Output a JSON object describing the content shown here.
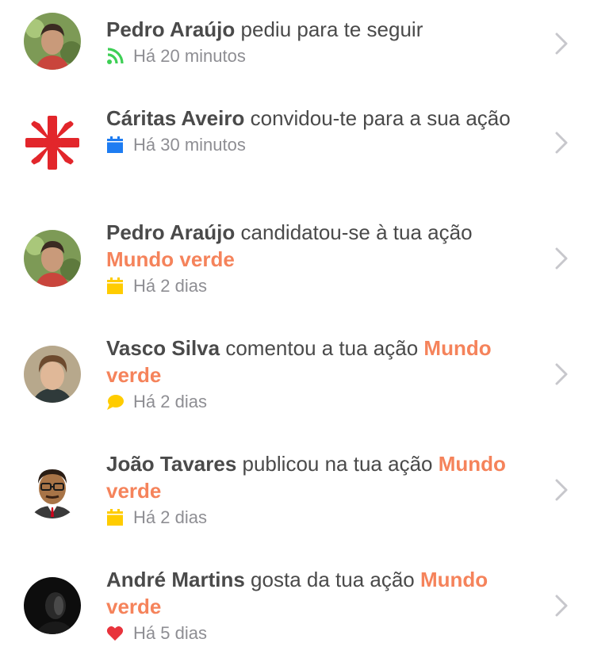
{
  "notifications": [
    {
      "actor": "Pedro Araújo",
      "action": "pediu para te seguir",
      "link": "",
      "time": "Há 20 minutos",
      "icon": "rss-icon",
      "icon_color": "#3ecf55"
    },
    {
      "actor": "Cáritas Aveiro",
      "action": "convidou-te para a sua ação",
      "link": "",
      "time": "Há 30 minutos",
      "icon": "calendar-icon",
      "icon_color": "#1e7cf2"
    },
    {
      "actor": "Pedro Araújo",
      "action": "candidatou-se à tua ação",
      "link": "Mundo verde",
      "time": "Há 2 dias",
      "icon": "calendar-icon",
      "icon_color": "#ffcc00"
    },
    {
      "actor": "Vasco Silva",
      "action": "comentou a tua ação",
      "link": "Mundo verde",
      "time": "Há 2 dias",
      "icon": "comment-bubble-icon",
      "icon_color": "#ffcc00"
    },
    {
      "actor": "João Tavares",
      "action": "publicou na tua ação",
      "link": "Mundo verde",
      "time": "Há 2 dias",
      "icon": "calendar-icon",
      "icon_color": "#ffcc00"
    },
    {
      "actor": "André Martins",
      "action": "gosta da tua ação",
      "link": "Mundo verde",
      "time": "Há 5 dias",
      "icon": "heart-icon",
      "icon_color": "#e8333c"
    }
  ],
  "colors": {
    "link": "#f5835b",
    "text": "#4a4a4a",
    "meta": "#8e8e93"
  }
}
